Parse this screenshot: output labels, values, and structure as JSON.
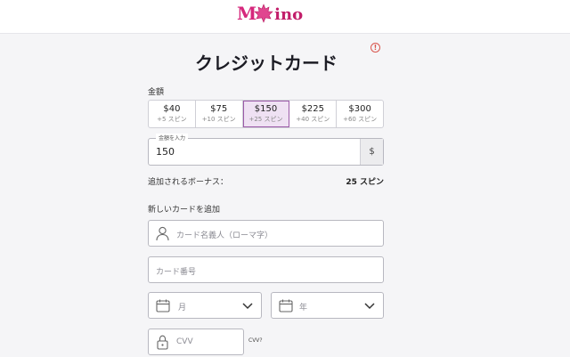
{
  "header": {
    "logo_text": "Mino",
    "logo_prefix": "M",
    "logo_suffix": "ino",
    "brand_color": "#c21e6a"
  },
  "page": {
    "title": "クレジットカード",
    "info_icon": "info-icon"
  },
  "amount": {
    "label": "金額",
    "options": [
      {
        "amount": "$40",
        "bonus": "+5 スピン",
        "selected": false
      },
      {
        "amount": "$75",
        "bonus": "+10 スピン",
        "selected": false
      },
      {
        "amount": "$150",
        "bonus": "+25 スピン",
        "selected": true
      },
      {
        "amount": "$225",
        "bonus": "+40 スピン",
        "selected": false
      },
      {
        "amount": "$300",
        "bonus": "+60 スピン",
        "selected": false
      }
    ],
    "input_label": "金額を入力",
    "input_value": "150",
    "currency": "$"
  },
  "bonus": {
    "label": "追加されるボーナス：",
    "value": "25 スピン"
  },
  "card": {
    "section_title": "新しいカードを追加",
    "name_placeholder": "カード名義人（ローマ字）",
    "number_placeholder": "カード番号",
    "month_placeholder": "月",
    "year_placeholder": "年",
    "cvv_placeholder": "CVV",
    "cvv_help": "CVV?"
  }
}
